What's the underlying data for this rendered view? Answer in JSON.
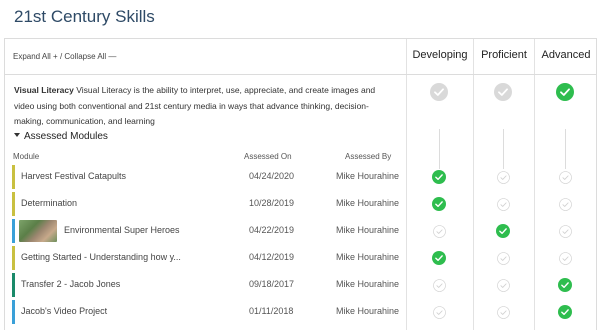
{
  "page": {
    "title": "21st Century Skills"
  },
  "controls": {
    "expand_all": "Expand All +",
    "divider": "/",
    "collapse_all": "Collapse All —"
  },
  "levels": {
    "developing": "Developing",
    "proficient": "Proficient",
    "advanced": "Advanced"
  },
  "skill": {
    "name": "Visual Literacy",
    "description": "Visual Literacy is the ability to interpret, use, appreciate, and create images and video using both conventional and 21st century media in ways that advance thinking, decision-making, communication, and learning",
    "overall_level": "Advanced"
  },
  "assessed": {
    "toggle_label": "Assessed Modules",
    "headers": {
      "module": "Module",
      "assessed_on": "Assessed On",
      "assessed_by": "Assessed By"
    },
    "modules": [
      {
        "name": "Harvest Festival Catapults",
        "date": "04/24/2020",
        "by": "Mike Hourahine",
        "level": "Developing",
        "bar_color": "#c9c040",
        "thumbnail": false
      },
      {
        "name": "Determination",
        "date": "10/28/2019",
        "by": "Mike Hourahine",
        "level": "Developing",
        "bar_color": "#c9c040",
        "thumbnail": false
      },
      {
        "name": "Environmental Super Heroes",
        "date": "04/22/2019",
        "by": "Mike Hourahine",
        "level": "Proficient",
        "bar_color": "#3aa0d8",
        "thumbnail": true
      },
      {
        "name": "Getting Started - Understanding how y...",
        "date": "04/12/2019",
        "by": "Mike Hourahine",
        "level": "Developing",
        "bar_color": "#c9c040",
        "thumbnail": false
      },
      {
        "name": "Transfer 2 - Jacob Jones",
        "date": "09/18/2017",
        "by": "Mike Hourahine",
        "level": "Advanced",
        "bar_color": "#1a8a6a",
        "thumbnail": false
      },
      {
        "name": "Jacob's Video Project",
        "date": "01/11/2018",
        "by": "Mike Hourahine",
        "level": "Advanced",
        "bar_color": "#3aa0d8",
        "thumbnail": false
      }
    ]
  },
  "colors": {
    "achieved": "#2ebd4e",
    "empty_outline": "#d0d0d0",
    "empty_fill": "#d9d9d9",
    "title": "#2e4a66"
  }
}
